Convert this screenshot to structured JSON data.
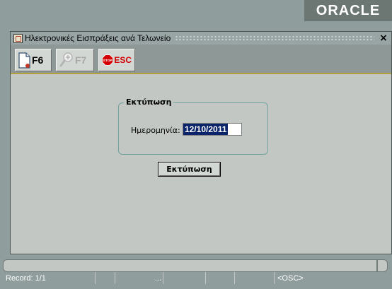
{
  "oracle_logo": "ORACLE",
  "window": {
    "title": "Ηλεκτρονικές Εισπράξεις ανά Τελωνείο",
    "close_label": "×"
  },
  "toolbar": {
    "f6_label": "F6",
    "f7_label": "F7",
    "esc_label": "ESC",
    "stop_text": "STOP"
  },
  "form": {
    "group_title": "Εκτύπωση",
    "date_label": "Ημερομηνία:",
    "date_value": "12/10/2011",
    "print_button": "Εκτύπωση"
  },
  "statusbar": {
    "record": "Record: 1/1",
    "ellipsis": "...",
    "osc": "<OSC>"
  },
  "colors": {
    "background": "#8f9e9c",
    "window_bg": "#c3c7c3",
    "selection": "#0a246a",
    "stop_red": "#d20000"
  }
}
